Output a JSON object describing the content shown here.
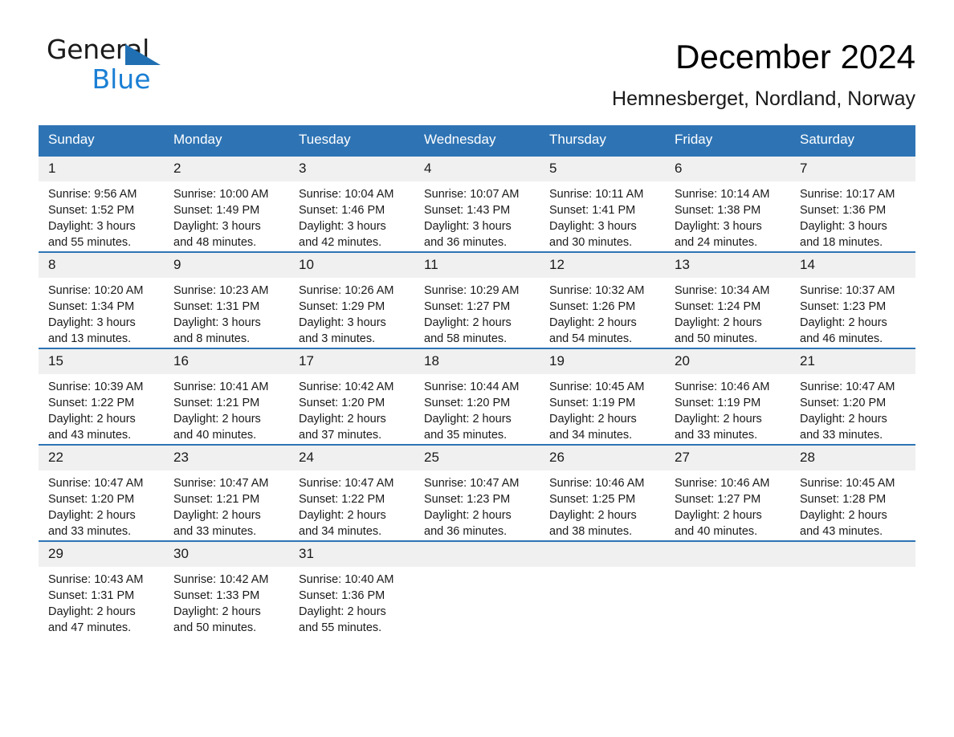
{
  "logo": {
    "word_one": "General",
    "word_two": "Blue",
    "triangle_color": "#1f6fb2",
    "blue_color": "#1a7fd4"
  },
  "header": {
    "month_title": "December 2024",
    "location": "Hemnesberget, Nordland, Norway"
  },
  "theme": {
    "header_blue": "#2e74b5",
    "daynum_background": "#f0f0f0",
    "text_color": "#1a1a1a"
  },
  "calendar": {
    "weekday_headers": [
      "Sunday",
      "Monday",
      "Tuesday",
      "Wednesday",
      "Thursday",
      "Friday",
      "Saturday"
    ],
    "weeks": [
      [
        {
          "day": "1",
          "sunrise": "Sunrise: 9:56 AM",
          "sunset": "Sunset: 1:52 PM",
          "daylight_line1": "Daylight: 3 hours",
          "daylight_line2": "and 55 minutes."
        },
        {
          "day": "2",
          "sunrise": "Sunrise: 10:00 AM",
          "sunset": "Sunset: 1:49 PM",
          "daylight_line1": "Daylight: 3 hours",
          "daylight_line2": "and 48 minutes."
        },
        {
          "day": "3",
          "sunrise": "Sunrise: 10:04 AM",
          "sunset": "Sunset: 1:46 PM",
          "daylight_line1": "Daylight: 3 hours",
          "daylight_line2": "and 42 minutes."
        },
        {
          "day": "4",
          "sunrise": "Sunrise: 10:07 AM",
          "sunset": "Sunset: 1:43 PM",
          "daylight_line1": "Daylight: 3 hours",
          "daylight_line2": "and 36 minutes."
        },
        {
          "day": "5",
          "sunrise": "Sunrise: 10:11 AM",
          "sunset": "Sunset: 1:41 PM",
          "daylight_line1": "Daylight: 3 hours",
          "daylight_line2": "and 30 minutes."
        },
        {
          "day": "6",
          "sunrise": "Sunrise: 10:14 AM",
          "sunset": "Sunset: 1:38 PM",
          "daylight_line1": "Daylight: 3 hours",
          "daylight_line2": "and 24 minutes."
        },
        {
          "day": "7",
          "sunrise": "Sunrise: 10:17 AM",
          "sunset": "Sunset: 1:36 PM",
          "daylight_line1": "Daylight: 3 hours",
          "daylight_line2": "and 18 minutes."
        }
      ],
      [
        {
          "day": "8",
          "sunrise": "Sunrise: 10:20 AM",
          "sunset": "Sunset: 1:34 PM",
          "daylight_line1": "Daylight: 3 hours",
          "daylight_line2": "and 13 minutes."
        },
        {
          "day": "9",
          "sunrise": "Sunrise: 10:23 AM",
          "sunset": "Sunset: 1:31 PM",
          "daylight_line1": "Daylight: 3 hours",
          "daylight_line2": "and 8 minutes."
        },
        {
          "day": "10",
          "sunrise": "Sunrise: 10:26 AM",
          "sunset": "Sunset: 1:29 PM",
          "daylight_line1": "Daylight: 3 hours",
          "daylight_line2": "and 3 minutes."
        },
        {
          "day": "11",
          "sunrise": "Sunrise: 10:29 AM",
          "sunset": "Sunset: 1:27 PM",
          "daylight_line1": "Daylight: 2 hours",
          "daylight_line2": "and 58 minutes."
        },
        {
          "day": "12",
          "sunrise": "Sunrise: 10:32 AM",
          "sunset": "Sunset: 1:26 PM",
          "daylight_line1": "Daylight: 2 hours",
          "daylight_line2": "and 54 minutes."
        },
        {
          "day": "13",
          "sunrise": "Sunrise: 10:34 AM",
          "sunset": "Sunset: 1:24 PM",
          "daylight_line1": "Daylight: 2 hours",
          "daylight_line2": "and 50 minutes."
        },
        {
          "day": "14",
          "sunrise": "Sunrise: 10:37 AM",
          "sunset": "Sunset: 1:23 PM",
          "daylight_line1": "Daylight: 2 hours",
          "daylight_line2": "and 46 minutes."
        }
      ],
      [
        {
          "day": "15",
          "sunrise": "Sunrise: 10:39 AM",
          "sunset": "Sunset: 1:22 PM",
          "daylight_line1": "Daylight: 2 hours",
          "daylight_line2": "and 43 minutes."
        },
        {
          "day": "16",
          "sunrise": "Sunrise: 10:41 AM",
          "sunset": "Sunset: 1:21 PM",
          "daylight_line1": "Daylight: 2 hours",
          "daylight_line2": "and 40 minutes."
        },
        {
          "day": "17",
          "sunrise": "Sunrise: 10:42 AM",
          "sunset": "Sunset: 1:20 PM",
          "daylight_line1": "Daylight: 2 hours",
          "daylight_line2": "and 37 minutes."
        },
        {
          "day": "18",
          "sunrise": "Sunrise: 10:44 AM",
          "sunset": "Sunset: 1:20 PM",
          "daylight_line1": "Daylight: 2 hours",
          "daylight_line2": "and 35 minutes."
        },
        {
          "day": "19",
          "sunrise": "Sunrise: 10:45 AM",
          "sunset": "Sunset: 1:19 PM",
          "daylight_line1": "Daylight: 2 hours",
          "daylight_line2": "and 34 minutes."
        },
        {
          "day": "20",
          "sunrise": "Sunrise: 10:46 AM",
          "sunset": "Sunset: 1:19 PM",
          "daylight_line1": "Daylight: 2 hours",
          "daylight_line2": "and 33 minutes."
        },
        {
          "day": "21",
          "sunrise": "Sunrise: 10:47 AM",
          "sunset": "Sunset: 1:20 PM",
          "daylight_line1": "Daylight: 2 hours",
          "daylight_line2": "and 33 minutes."
        }
      ],
      [
        {
          "day": "22",
          "sunrise": "Sunrise: 10:47 AM",
          "sunset": "Sunset: 1:20 PM",
          "daylight_line1": "Daylight: 2 hours",
          "daylight_line2": "and 33 minutes."
        },
        {
          "day": "23",
          "sunrise": "Sunrise: 10:47 AM",
          "sunset": "Sunset: 1:21 PM",
          "daylight_line1": "Daylight: 2 hours",
          "daylight_line2": "and 33 minutes."
        },
        {
          "day": "24",
          "sunrise": "Sunrise: 10:47 AM",
          "sunset": "Sunset: 1:22 PM",
          "daylight_line1": "Daylight: 2 hours",
          "daylight_line2": "and 34 minutes."
        },
        {
          "day": "25",
          "sunrise": "Sunrise: 10:47 AM",
          "sunset": "Sunset: 1:23 PM",
          "daylight_line1": "Daylight: 2 hours",
          "daylight_line2": "and 36 minutes."
        },
        {
          "day": "26",
          "sunrise": "Sunrise: 10:46 AM",
          "sunset": "Sunset: 1:25 PM",
          "daylight_line1": "Daylight: 2 hours",
          "daylight_line2": "and 38 minutes."
        },
        {
          "day": "27",
          "sunrise": "Sunrise: 10:46 AM",
          "sunset": "Sunset: 1:27 PM",
          "daylight_line1": "Daylight: 2 hours",
          "daylight_line2": "and 40 minutes."
        },
        {
          "day": "28",
          "sunrise": "Sunrise: 10:45 AM",
          "sunset": "Sunset: 1:28 PM",
          "daylight_line1": "Daylight: 2 hours",
          "daylight_line2": "and 43 minutes."
        }
      ],
      [
        {
          "day": "29",
          "sunrise": "Sunrise: 10:43 AM",
          "sunset": "Sunset: 1:31 PM",
          "daylight_line1": "Daylight: 2 hours",
          "daylight_line2": "and 47 minutes."
        },
        {
          "day": "30",
          "sunrise": "Sunrise: 10:42 AM",
          "sunset": "Sunset: 1:33 PM",
          "daylight_line1": "Daylight: 2 hours",
          "daylight_line2": "and 50 minutes."
        },
        {
          "day": "31",
          "sunrise": "Sunrise: 10:40 AM",
          "sunset": "Sunset: 1:36 PM",
          "daylight_line1": "Daylight: 2 hours",
          "daylight_line2": "and 55 minutes."
        },
        {
          "day": "",
          "sunrise": "",
          "sunset": "",
          "daylight_line1": "",
          "daylight_line2": ""
        },
        {
          "day": "",
          "sunrise": "",
          "sunset": "",
          "daylight_line1": "",
          "daylight_line2": ""
        },
        {
          "day": "",
          "sunrise": "",
          "sunset": "",
          "daylight_line1": "",
          "daylight_line2": ""
        },
        {
          "day": "",
          "sunrise": "",
          "sunset": "",
          "daylight_line1": "",
          "daylight_line2": ""
        }
      ]
    ]
  }
}
